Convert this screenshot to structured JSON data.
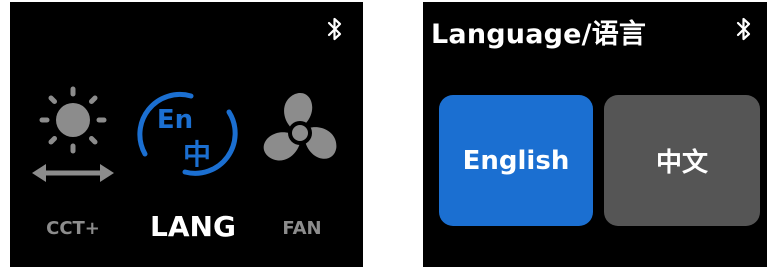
{
  "left_screen": {
    "menu": [
      {
        "id": "cct",
        "label": "CCT+",
        "icon": "sun-arrows-icon"
      },
      {
        "id": "lang",
        "label": "LANG",
        "icon": "language-en-zh-icon",
        "selected": true
      },
      {
        "id": "fan",
        "label": "FAN",
        "icon": "fan-icon"
      }
    ],
    "lang_icon_text": {
      "en": "En",
      "zh": "中"
    }
  },
  "right_screen": {
    "title": "Language/语言",
    "options": [
      {
        "label": "English",
        "selected": true
      },
      {
        "label": "中文",
        "selected": false
      }
    ]
  },
  "colors": {
    "accent": "#1b6fd1",
    "dim": "#8c8c8c",
    "button_inactive": "#555555",
    "background": "#000000"
  }
}
